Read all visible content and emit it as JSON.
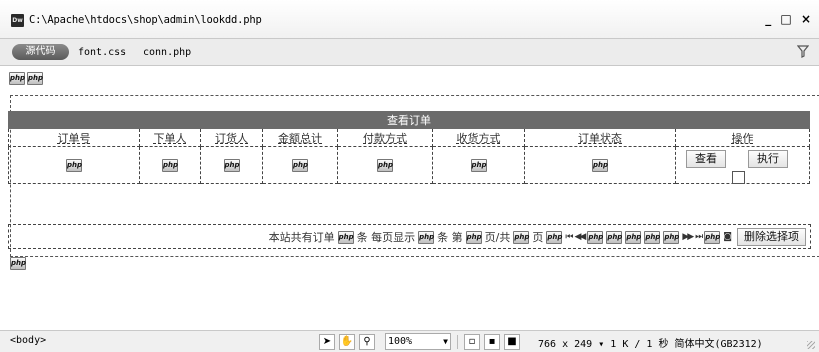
{
  "window": {
    "app_icon_text": "Dw",
    "title": "C:\\Apache\\htdocs\\shop\\admin\\lookdd.php",
    "minimize_glyph": "_",
    "maximize_glyph": "□",
    "close_glyph": "×"
  },
  "related_files": {
    "source_button": "源代码",
    "files": [
      "font.css",
      "conn.php"
    ]
  },
  "design": {
    "php_marker": "php",
    "table": {
      "caption": "查看订单",
      "headers": [
        "订单号",
        "下单人",
        "订货人",
        "金额总计",
        "付款方式",
        "收货方式",
        "订单状态",
        "操作"
      ],
      "view_button": "查看",
      "execute_button": "执行"
    },
    "pager": {
      "total_prefix": "本站共有订单",
      "per_page_label": "条 每页显示",
      "count_unit": "条 第",
      "page_of_label": "页/共",
      "page_suffix": "页",
      "delete_button": "删除选择项"
    }
  },
  "statusbar": {
    "tag": "<body>",
    "zoom": "100%",
    "dimensions": "766 x 249",
    "size_time": "1 K / 1 秒",
    "encoding": "简体中文(GB2312)"
  }
}
